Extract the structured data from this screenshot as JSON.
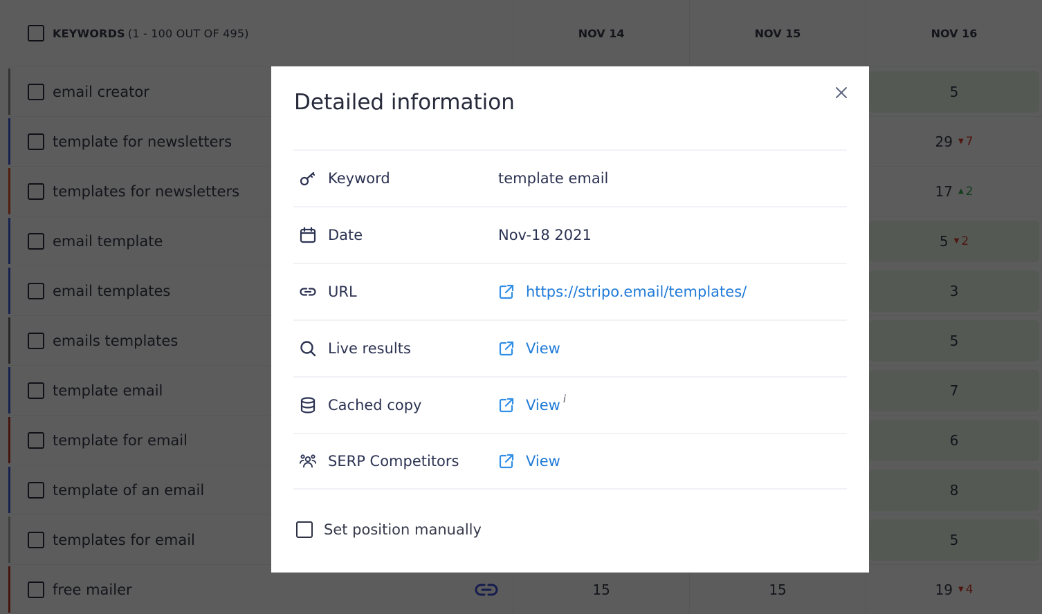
{
  "table": {
    "header": {
      "keywords_label": "KEYWORDS",
      "keywords_count": "(1 - 100 OUT OF 495)",
      "dates": [
        "NOV 14",
        "NOV 15",
        "NOV 16"
      ]
    },
    "rows": [
      {
        "keyword": "email creator",
        "accent": "#8a8f8a",
        "nov14": "",
        "nov15": "",
        "nov16": "5",
        "delta": "",
        "delta_dir": "",
        "top10": true
      },
      {
        "keyword": "template for newsletters",
        "accent": "#3d5bd9",
        "nov14": "",
        "nov15": "",
        "nov16": "29",
        "delta": "7",
        "delta_dir": "down",
        "top10": false
      },
      {
        "keyword": "templates for newsletters",
        "accent": "#e0502a",
        "nov14": "",
        "nov15": "",
        "nov16": "17",
        "delta": "2",
        "delta_dir": "up",
        "top10": false
      },
      {
        "keyword": "email template",
        "accent": "#3d5bd9",
        "nov14": "",
        "nov15": "",
        "nov16": "5",
        "delta": "2",
        "delta_dir": "down",
        "top10": true
      },
      {
        "keyword": "email templates",
        "accent": "#3d5bd9",
        "nov14": "",
        "nov15": "",
        "nov16": "3",
        "delta": "",
        "delta_dir": "",
        "top10": true
      },
      {
        "keyword": "emails templates",
        "accent": "#6b6b6b",
        "nov14": "",
        "nov15": "",
        "nov16": "5",
        "delta": "",
        "delta_dir": "",
        "top10": true
      },
      {
        "keyword": "template email",
        "accent": "#3d5bd9",
        "nov14": "",
        "nov15": "",
        "nov16": "7",
        "delta": "",
        "delta_dir": "",
        "top10": true
      },
      {
        "keyword": "template for email",
        "accent": "#c0392b",
        "nov14": "",
        "nov15": "",
        "nov16": "6",
        "delta": "",
        "delta_dir": "",
        "top10": true
      },
      {
        "keyword": "template of an email",
        "accent": "#3d5bd9",
        "nov14": "",
        "nov15": "",
        "nov16": "8",
        "delta": "",
        "delta_dir": "",
        "top10": true
      },
      {
        "keyword": "templates for email",
        "accent": "#a9b0a9",
        "nov14": "",
        "nov15": "",
        "nov16": "5",
        "delta": "",
        "delta_dir": "",
        "top10": true
      },
      {
        "keyword": "free mailer",
        "accent": "#c0392b",
        "nov14": "15",
        "nov15": "15",
        "nov16": "19",
        "delta": "4",
        "delta_dir": "down",
        "top10": false,
        "has_url_icon": true
      }
    ],
    "colors": {
      "top10_bg": "#e8f6e8",
      "delta_down": "#d93a2b",
      "delta_up": "#34a853",
      "link_icon": "#3b4fd8"
    }
  },
  "modal": {
    "title": "Detailed information",
    "close_label": "×",
    "details": [
      {
        "icon": "key-icon",
        "label": "Keyword",
        "value": "template email",
        "is_link": false
      },
      {
        "icon": "calendar-icon",
        "label": "Date",
        "value": "Nov-18 2021",
        "is_link": false
      },
      {
        "icon": "link-icon",
        "label": "URL",
        "value": "https://stripo.email/templates/",
        "is_link": true
      },
      {
        "icon": "search-icon",
        "label": "Live results",
        "value": "View",
        "is_link": true
      },
      {
        "icon": "database-icon",
        "label": "Cached copy",
        "value": "View",
        "is_link": true,
        "info": "i"
      },
      {
        "icon": "users-icon",
        "label": "SERP Competitors",
        "value": "View",
        "is_link": true
      }
    ],
    "manual_checkbox_label": "Set position manually",
    "manual_checkbox_checked": false,
    "colors": {
      "link": "#1f7ad8",
      "text": "#2c3352"
    }
  }
}
